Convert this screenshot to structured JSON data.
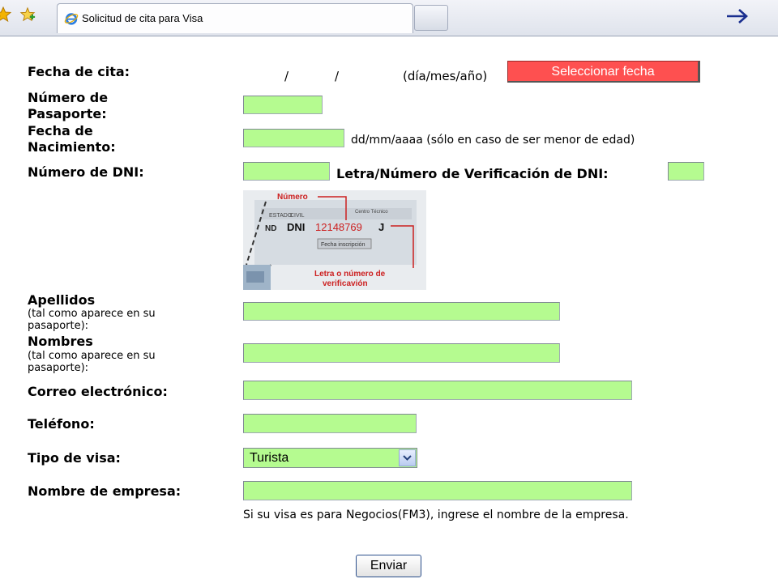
{
  "browser": {
    "tab_title": "Solicitud de cita para Visa"
  },
  "form": {
    "fecha_cita": {
      "label": "Fecha de cita:",
      "sep1": "/",
      "sep2": "/",
      "format_hint": "(día/mes/año)",
      "button": "Seleccionar fecha"
    },
    "pasaporte": {
      "label_line1": "Número de",
      "label_line2": "Pasaporte:"
    },
    "nacimiento": {
      "label_line1": "Fecha de",
      "label_line2": "Nacimiento:",
      "hint": "dd/mm/aaaa (sólo en caso de ser menor de edad)"
    },
    "dni": {
      "label": "Número de DNI:",
      "verif_label": "Letra/Número de Verificación de DNI:"
    },
    "dni_image": {
      "caption_top": "Número",
      "dni_text": "DNI",
      "dni_number": "12148769",
      "dni_letter": "J",
      "card_field1": "ESTADO",
      "card_field2": "CIVIL",
      "card_field3": "Centro Técnico",
      "card_button": "Fecha inscripción",
      "card_left": "ND",
      "caption_bottom_line1": "Letra o número de",
      "caption_bottom_line2": "verificavión"
    },
    "apellidos": {
      "label": "Apellidos",
      "sub_line1": "(tal como aparece en su",
      "sub_line2": "pasaporte):"
    },
    "nombres": {
      "label": "Nombres",
      "sub_line1": "(tal como aparece en su",
      "sub_line2": "pasaporte):"
    },
    "correo": {
      "label": "Correo electrónico:"
    },
    "telefono": {
      "label": "Teléfono:"
    },
    "tipo_visa": {
      "label": "Tipo de visa:",
      "selected": "Turista"
    },
    "empresa": {
      "label": "Nombre de empresa:",
      "hint": "Si su visa es para Negocios(FM3), ingrese el nombre de la empresa."
    },
    "submit": "Enviar"
  },
  "colors": {
    "field_bg": "#b5fb90",
    "button_red": "#fe5050",
    "caption_red": "#cc2020"
  }
}
